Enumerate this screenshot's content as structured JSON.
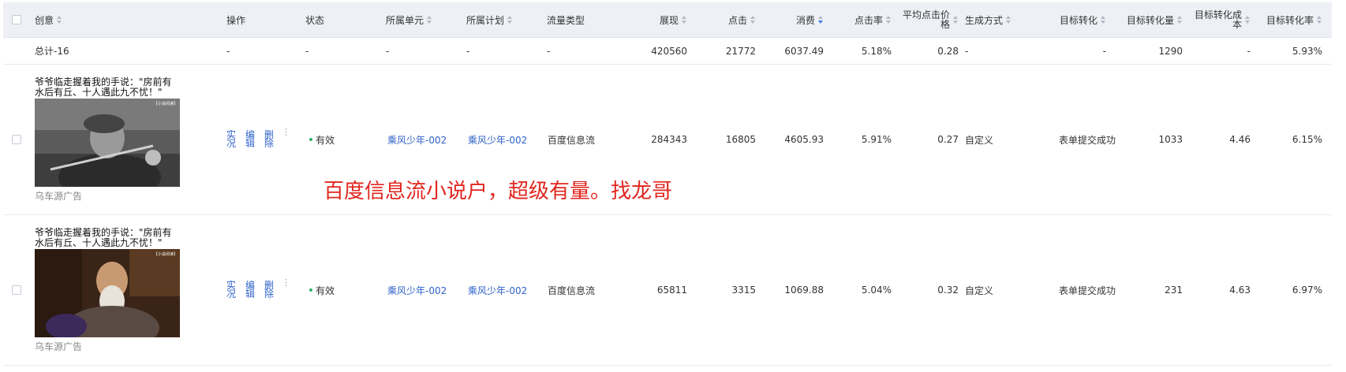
{
  "columns": {
    "creative": "创意",
    "operation": "操作",
    "status": "状态",
    "unit": "所属单元",
    "plan": "所属计划",
    "traffic": "流量类型",
    "impressions": "展现",
    "clicks": "点击",
    "cost": "消费",
    "ctr": "点击率",
    "cpc_line1": "平均点击价",
    "cpc_line2": "格",
    "gen": "生成方式",
    "conv_target": "目标转化",
    "conv_volume": "目标转化量",
    "conv_cost_line1": "目标转化成",
    "conv_cost_line2": "本",
    "conv_rate": "目标转化率"
  },
  "sort_column": "cost",
  "total": {
    "label": "总计-16",
    "operation": "-",
    "status": "-",
    "unit": "-",
    "plan": "-",
    "traffic": "-",
    "impressions": "420560",
    "clicks": "21772",
    "cost": "6037.49",
    "ctr": "5.18%",
    "cpc": "0.28",
    "gen": "-",
    "conv_target": "-",
    "conv_volume": "1290",
    "conv_cost": "-",
    "conv_rate": "5.93%"
  },
  "rows": [
    {
      "title": "爷爷临走握着我的手说：\"房前有水后有丘、十人遇此九不忧！\"",
      "source": "乌车源广告",
      "watermark": "【小说阅读】",
      "ops": [
        "实况",
        "编辑",
        "删除"
      ],
      "more": "⋮",
      "status": "有效",
      "unit": "乘风少年-002",
      "plan": "乘风少年-002",
      "traffic": "百度信息流",
      "impressions": "284343",
      "clicks": "16805",
      "cost": "4605.93",
      "ctr": "5.91%",
      "cpc": "0.27",
      "gen": "自定义",
      "conv_target": "表单提交成功",
      "conv_volume": "1033",
      "conv_cost": "4.46",
      "conv_rate": "6.15%"
    },
    {
      "title": "爷爷临走握着我的手说：\"房前有水后有丘、十人遇此九不忧！\"",
      "source": "乌车源广告",
      "watermark": "【小说阅读】",
      "ops": [
        "实况",
        "编辑",
        "删除"
      ],
      "more": "⋮",
      "status": "有效",
      "unit": "乘风少年-002",
      "plan": "乘风少年-002",
      "traffic": "百度信息流",
      "impressions": "65811",
      "clicks": "3315",
      "cost": "1069.88",
      "ctr": "5.04%",
      "cpc": "0.32",
      "gen": "自定义",
      "conv_target": "表单提交成功",
      "conv_volume": "231",
      "conv_cost": "4.63",
      "conv_rate": "6.97%"
    }
  ],
  "overlay_text": "百度信息流小说户，超级有量。找龙哥",
  "colors": {
    "link": "#2f63c9",
    "status_ok": "#2fb363",
    "overlay": "#e0261f",
    "header_bg": "#eef0f6"
  }
}
